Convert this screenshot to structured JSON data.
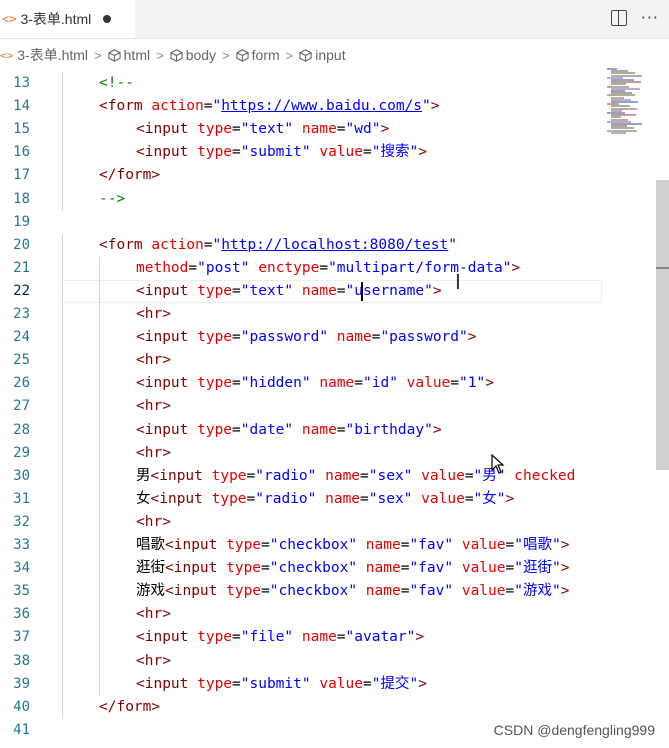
{
  "tab": {
    "file_icon": "<>",
    "filename": "3-表单.html",
    "modified": true
  },
  "tab_actions": {
    "split_icon": "split-editor-icon",
    "more_icon": "more-actions-icon",
    "more_label": "···"
  },
  "breadcrumb": [
    {
      "label": "3-表单.html",
      "icon": "html-file-icon"
    },
    {
      "label": "html",
      "icon": "element-cube-icon"
    },
    {
      "label": "body",
      "icon": "element-cube-icon"
    },
    {
      "label": "form",
      "icon": "element-cube-icon"
    },
    {
      "label": "input",
      "icon": "element-cube-icon"
    }
  ],
  "editor": {
    "active_line": 22,
    "lines": [
      {
        "n": 13,
        "indent": 1,
        "tokens": [
          [
            "cm",
            "<!--"
          ]
        ]
      },
      {
        "n": 14,
        "indent": 1,
        "tokens": [
          [
            "tg",
            "<form "
          ],
          [
            "at",
            "action"
          ],
          [
            "tx",
            "="
          ],
          [
            "vl",
            "\""
          ],
          [
            "vlu",
            "https://www.baidu.com/s"
          ],
          [
            "vl",
            "\""
          ],
          [
            "tg",
            ">"
          ]
        ]
      },
      {
        "n": 15,
        "indent": 2,
        "tokens": [
          [
            "tg",
            "<input "
          ],
          [
            "at",
            "type"
          ],
          [
            "tx",
            "="
          ],
          [
            "vl",
            "\"text\" "
          ],
          [
            "at",
            "name"
          ],
          [
            "tx",
            "="
          ],
          [
            "vl",
            "\"wd\""
          ],
          [
            "tg",
            ">"
          ]
        ]
      },
      {
        "n": 16,
        "indent": 2,
        "tokens": [
          [
            "tg",
            "<input "
          ],
          [
            "at",
            "type"
          ],
          [
            "tx",
            "="
          ],
          [
            "vl",
            "\"submit\" "
          ],
          [
            "at",
            "value"
          ],
          [
            "tx",
            "="
          ],
          [
            "vl",
            "\"搜索\""
          ],
          [
            "tg",
            ">"
          ]
        ]
      },
      {
        "n": 17,
        "indent": 1,
        "tokens": [
          [
            "tg",
            "</form>"
          ]
        ]
      },
      {
        "n": 18,
        "indent": 1,
        "tokens": [
          [
            "cm",
            "-->"
          ]
        ]
      },
      {
        "n": 19,
        "indent": 0,
        "tokens": []
      },
      {
        "n": 20,
        "indent": 1,
        "tokens": [
          [
            "tg",
            "<form "
          ],
          [
            "at",
            "action"
          ],
          [
            "tx",
            "="
          ],
          [
            "vl",
            "\""
          ],
          [
            "vlu",
            "http://localhost:8080/test"
          ],
          [
            "vl",
            "\""
          ]
        ]
      },
      {
        "n": 21,
        "indent": 2,
        "tokens": [
          [
            "at",
            "method"
          ],
          [
            "tx",
            "="
          ],
          [
            "vl",
            "\"post\" "
          ],
          [
            "at",
            "enctype"
          ],
          [
            "tx",
            "="
          ],
          [
            "vl",
            "\"multipart/form-data\""
          ],
          [
            "tg",
            ">"
          ]
        ]
      },
      {
        "n": 22,
        "indent": 2,
        "tokens": [
          [
            "tg",
            "<input "
          ],
          [
            "at",
            "type"
          ],
          [
            "tx",
            "="
          ],
          [
            "vl",
            "\"text\" "
          ],
          [
            "at",
            "name"
          ],
          [
            "tx",
            "="
          ],
          [
            "vl",
            "\"username\""
          ],
          [
            "tg",
            ">"
          ]
        ]
      },
      {
        "n": 23,
        "indent": 2,
        "tokens": [
          [
            "tg",
            "<hr>"
          ]
        ]
      },
      {
        "n": 24,
        "indent": 2,
        "tokens": [
          [
            "tg",
            "<input "
          ],
          [
            "at",
            "type"
          ],
          [
            "tx",
            "="
          ],
          [
            "vl",
            "\"password\" "
          ],
          [
            "at",
            "name"
          ],
          [
            "tx",
            "="
          ],
          [
            "vl",
            "\"password\""
          ],
          [
            "tg",
            ">"
          ]
        ]
      },
      {
        "n": 25,
        "indent": 2,
        "tokens": [
          [
            "tg",
            "<hr>"
          ]
        ]
      },
      {
        "n": 26,
        "indent": 2,
        "tokens": [
          [
            "tg",
            "<input "
          ],
          [
            "at",
            "type"
          ],
          [
            "tx",
            "="
          ],
          [
            "vl",
            "\"hidden\" "
          ],
          [
            "at",
            "name"
          ],
          [
            "tx",
            "="
          ],
          [
            "vl",
            "\"id\" "
          ],
          [
            "at",
            "value"
          ],
          [
            "tx",
            "="
          ],
          [
            "vl",
            "\"1\""
          ],
          [
            "tg",
            ">"
          ]
        ]
      },
      {
        "n": 27,
        "indent": 2,
        "tokens": [
          [
            "tg",
            "<hr>"
          ]
        ]
      },
      {
        "n": 28,
        "indent": 2,
        "tokens": [
          [
            "tg",
            "<input "
          ],
          [
            "at",
            "type"
          ],
          [
            "tx",
            "="
          ],
          [
            "vl",
            "\"date\" "
          ],
          [
            "at",
            "name"
          ],
          [
            "tx",
            "="
          ],
          [
            "vl",
            "\"birthday\""
          ],
          [
            "tg",
            ">"
          ]
        ]
      },
      {
        "n": 29,
        "indent": 2,
        "tokens": [
          [
            "tg",
            "<hr>"
          ]
        ]
      },
      {
        "n": 30,
        "indent": 2,
        "tokens": [
          [
            "tx",
            "男"
          ],
          [
            "tg",
            "<input "
          ],
          [
            "at",
            "type"
          ],
          [
            "tx",
            "="
          ],
          [
            "vl",
            "\"radio\" "
          ],
          [
            "at",
            "name"
          ],
          [
            "tx",
            "="
          ],
          [
            "vl",
            "\"sex\" "
          ],
          [
            "at",
            "value"
          ],
          [
            "tx",
            "="
          ],
          [
            "vl",
            "\"男\" "
          ],
          [
            "at",
            "checked"
          ]
        ]
      },
      {
        "n": 31,
        "indent": 2,
        "tokens": [
          [
            "tx",
            "女"
          ],
          [
            "tg",
            "<input "
          ],
          [
            "at",
            "type"
          ],
          [
            "tx",
            "="
          ],
          [
            "vl",
            "\"radio\" "
          ],
          [
            "at",
            "name"
          ],
          [
            "tx",
            "="
          ],
          [
            "vl",
            "\"sex\" "
          ],
          [
            "at",
            "value"
          ],
          [
            "tx",
            "="
          ],
          [
            "vl",
            "\"女\""
          ],
          [
            "tg",
            ">"
          ]
        ]
      },
      {
        "n": 32,
        "indent": 2,
        "tokens": [
          [
            "tg",
            "<hr>"
          ]
        ]
      },
      {
        "n": 33,
        "indent": 2,
        "tokens": [
          [
            "tx",
            "唱歌"
          ],
          [
            "tg",
            "<input "
          ],
          [
            "at",
            "type"
          ],
          [
            "tx",
            "="
          ],
          [
            "vl",
            "\"checkbox\" "
          ],
          [
            "at",
            "name"
          ],
          [
            "tx",
            "="
          ],
          [
            "vl",
            "\"fav\" "
          ],
          [
            "at",
            "value"
          ],
          [
            "tx",
            "="
          ],
          [
            "vl",
            "\"唱歌\""
          ],
          [
            "tg",
            ">"
          ]
        ]
      },
      {
        "n": 34,
        "indent": 2,
        "tokens": [
          [
            "tx",
            "逛街"
          ],
          [
            "tg",
            "<input "
          ],
          [
            "at",
            "type"
          ],
          [
            "tx",
            "="
          ],
          [
            "vl",
            "\"checkbox\" "
          ],
          [
            "at",
            "name"
          ],
          [
            "tx",
            "="
          ],
          [
            "vl",
            "\"fav\" "
          ],
          [
            "at",
            "value"
          ],
          [
            "tx",
            "="
          ],
          [
            "vl",
            "\"逛街\""
          ],
          [
            "tg",
            ">"
          ]
        ]
      },
      {
        "n": 35,
        "indent": 2,
        "tokens": [
          [
            "tx",
            "游戏"
          ],
          [
            "tg",
            "<input "
          ],
          [
            "at",
            "type"
          ],
          [
            "tx",
            "="
          ],
          [
            "vl",
            "\"checkbox\" "
          ],
          [
            "at",
            "name"
          ],
          [
            "tx",
            "="
          ],
          [
            "vl",
            "\"fav\" "
          ],
          [
            "at",
            "value"
          ],
          [
            "tx",
            "="
          ],
          [
            "vl",
            "\"游戏\""
          ],
          [
            "tg",
            ">"
          ]
        ]
      },
      {
        "n": 36,
        "indent": 2,
        "tokens": [
          [
            "tg",
            "<hr>"
          ]
        ]
      },
      {
        "n": 37,
        "indent": 2,
        "tokens": [
          [
            "tg",
            "<input "
          ],
          [
            "at",
            "type"
          ],
          [
            "tx",
            "="
          ],
          [
            "vl",
            "\"file\" "
          ],
          [
            "at",
            "name"
          ],
          [
            "tx",
            "="
          ],
          [
            "vl",
            "\"avatar\""
          ],
          [
            "tg",
            ">"
          ]
        ]
      },
      {
        "n": 38,
        "indent": 2,
        "tokens": [
          [
            "tg",
            "<hr>"
          ]
        ]
      },
      {
        "n": 39,
        "indent": 2,
        "tokens": [
          [
            "tg",
            "<input "
          ],
          [
            "at",
            "type"
          ],
          [
            "tx",
            "="
          ],
          [
            "vl",
            "\"submit\" "
          ],
          [
            "at",
            "value"
          ],
          [
            "tx",
            "="
          ],
          [
            "vl",
            "\"提交\""
          ],
          [
            "tg",
            ">"
          ]
        ]
      },
      {
        "n": 40,
        "indent": 1,
        "tokens": [
          [
            "tg",
            "</form>"
          ]
        ]
      },
      {
        "n": 41,
        "indent": 0,
        "tokens": []
      }
    ]
  },
  "watermark": "CSDN @dengfengling999"
}
